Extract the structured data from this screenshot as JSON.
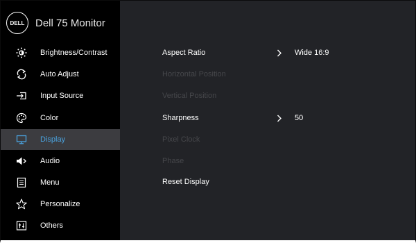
{
  "brand": {
    "logo_text": "DELL",
    "title": "Dell 75 Monitor"
  },
  "menu": [
    {
      "label": "Brightness/Contrast",
      "icon": "brightness-icon"
    },
    {
      "label": "Auto Adjust",
      "icon": "auto-adjust-icon"
    },
    {
      "label": "Input Source",
      "icon": "input-source-icon"
    },
    {
      "label": "Color",
      "icon": "color-palette-icon"
    },
    {
      "label": "Display",
      "icon": "display-icon",
      "active": true
    },
    {
      "label": "Audio",
      "icon": "speaker-icon"
    },
    {
      "label": "Menu",
      "icon": "menu-icon"
    },
    {
      "label": "Personalize",
      "icon": "star-icon"
    },
    {
      "label": "Others",
      "icon": "others-icon"
    }
  ],
  "display": {
    "aspect_ratio": {
      "label": "Aspect Ratio",
      "value": "Wide 16:9"
    },
    "horizontal_position": {
      "label": "Horizontal Position"
    },
    "vertical_position": {
      "label": "Vertical Position"
    },
    "sharpness": {
      "label": "Sharpness",
      "value": "50"
    },
    "pixel_clock": {
      "label": "Pixel Clock"
    },
    "phase": {
      "label": "Phase"
    },
    "reset_display": {
      "label": "Reset Display"
    }
  },
  "colors": {
    "background": "#222327",
    "sidebar": "#000000",
    "active_bg": "#3c3c40",
    "accent": "#4aa3df",
    "disabled_text": "#46474b"
  }
}
